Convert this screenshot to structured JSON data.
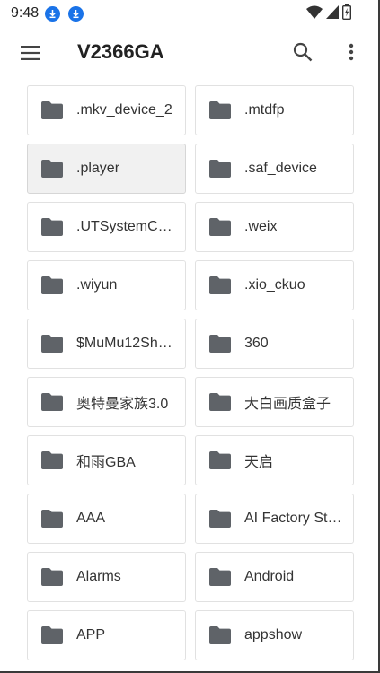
{
  "status_bar": {
    "time": "9:48",
    "notifications": [
      "download-icon",
      "download-icon"
    ],
    "indicators": [
      "wifi-icon",
      "signal-icon",
      "battery-icon"
    ]
  },
  "app_bar": {
    "title": "V2366GA",
    "menu_icon": "menu-icon",
    "search_icon": "search-icon",
    "more_icon": "more-vert-icon"
  },
  "colors": {
    "accent": "#1a73e8",
    "folder": "#5f6368",
    "text": "#333333",
    "tile_border": "#e1e1e1",
    "selected_tile": "#f1f1f1"
  },
  "folders": [
    {
      "label": ".mkv_device_2",
      "selected": false
    },
    {
      "label": ".mtdfp",
      "selected": false
    },
    {
      "label": ".player",
      "selected": true
    },
    {
      "label": ".saf_device",
      "selected": false
    },
    {
      "label": ".UTSystemC…",
      "selected": false
    },
    {
      "label": ".weix",
      "selected": false
    },
    {
      "label": ".wiyun",
      "selected": false
    },
    {
      "label": ".xio_ckuo",
      "selected": false
    },
    {
      "label": "$MuMu12Sh…",
      "selected": false
    },
    {
      "label": "360",
      "selected": false
    },
    {
      "label": "奥特曼家族3.0",
      "selected": false
    },
    {
      "label": "大白画质盒子",
      "selected": false
    },
    {
      "label": "和雨GBA",
      "selected": false
    },
    {
      "label": "天启",
      "selected": false
    },
    {
      "label": "AAA",
      "selected": false
    },
    {
      "label": "AI Factory St…",
      "selected": false
    },
    {
      "label": "Alarms",
      "selected": false
    },
    {
      "label": "Android",
      "selected": false
    },
    {
      "label": "APP",
      "selected": false
    },
    {
      "label": "appshow",
      "selected": false
    }
  ]
}
